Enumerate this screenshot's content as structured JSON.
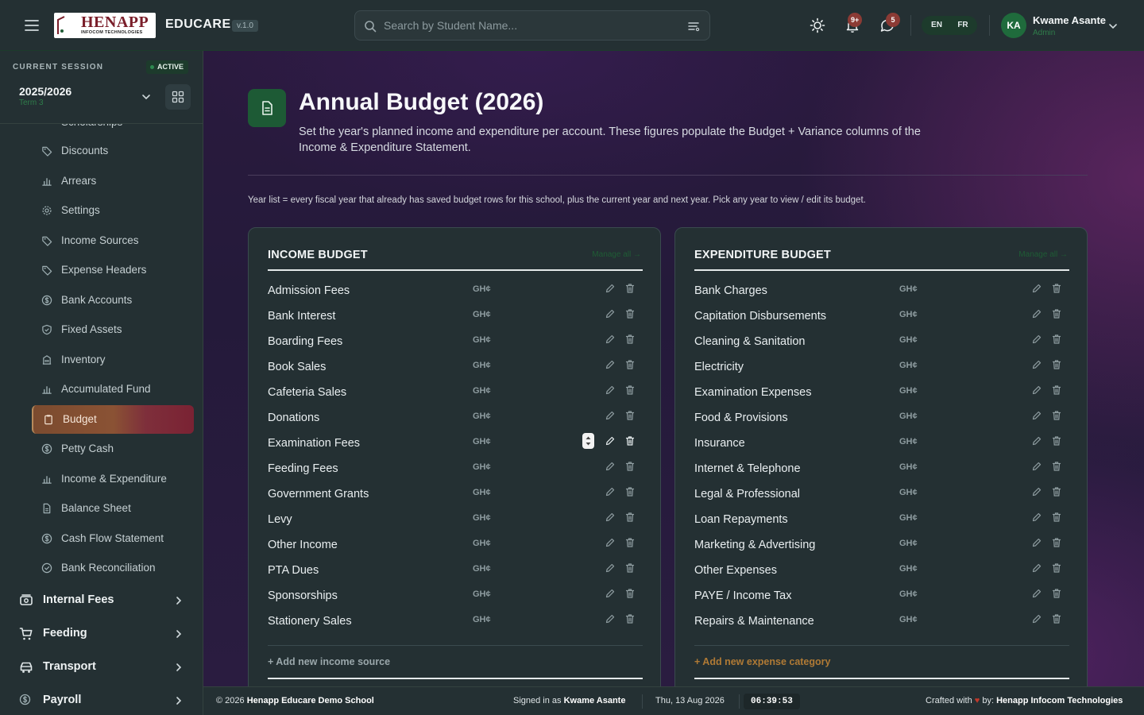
{
  "app": {
    "logo_text": "HENAPP",
    "logo_sub": "INFOCOM TECHNOLOGIES",
    "name": "EDUCARE",
    "version": "v.1.0"
  },
  "header": {
    "search_placeholder": "Search by Student Name...",
    "notifications_count": "9+",
    "messages_count": "5",
    "languages": [
      "EN",
      "FR"
    ],
    "user": {
      "initials": "KA",
      "name": "Kwame Asante",
      "role": "Admin"
    }
  },
  "session": {
    "label": "CURRENT SESSION",
    "status": "ACTIVE",
    "year": "2025/2026",
    "term": "Term 3"
  },
  "sidebar": {
    "partial_item": "Scholarships",
    "items": [
      {
        "label": "Discounts",
        "icon": "tag-icon"
      },
      {
        "label": "Arrears",
        "icon": "bar-chart-icon"
      },
      {
        "label": "Settings",
        "icon": "gear-icon"
      },
      {
        "label": "Income Sources",
        "icon": "tag-icon"
      },
      {
        "label": "Expense Headers",
        "icon": "tag-icon"
      },
      {
        "label": "Bank Accounts",
        "icon": "dollar-circle-icon"
      },
      {
        "label": "Fixed Assets",
        "icon": "shield-icon"
      },
      {
        "label": "Inventory",
        "icon": "building-icon"
      },
      {
        "label": "Accumulated Fund",
        "icon": "bar-chart-icon"
      },
      {
        "label": "Budget",
        "icon": "clipboard-icon",
        "active": true
      },
      {
        "label": "Petty Cash",
        "icon": "dollar-circle-icon"
      },
      {
        "label": "Income & Expenditure",
        "icon": "bar-chart-icon"
      },
      {
        "label": "Balance Sheet",
        "icon": "document-icon"
      },
      {
        "label": "Cash Flow Statement",
        "icon": "dollar-circle-icon"
      },
      {
        "label": "Bank Reconciliation",
        "icon": "check-circle-icon"
      }
    ],
    "groups": [
      {
        "label": "Internal Fees",
        "icon": "cash-icon"
      },
      {
        "label": "Feeding",
        "icon": "cart-icon"
      },
      {
        "label": "Transport",
        "icon": "car-icon"
      },
      {
        "label": "Payroll",
        "icon": "dollar-circle-icon"
      }
    ]
  },
  "page": {
    "title": "Annual Budget (2026)",
    "description": "Set the year's planned income and expenditure per account. These figures populate the Budget + Variance columns of the Income & Expenditure Statement.",
    "help_text": "Year list = every fiscal year that already has saved budget rows for this school, plus the current year and next year. Pick any year to view / edit its budget."
  },
  "income_budget": {
    "title": "INCOME BUDGET",
    "manage_label": "Manage all →",
    "currency": "GH¢",
    "rows": [
      "Admission Fees",
      "Bank Interest",
      "Boarding Fees",
      "Book Sales",
      "Cafeteria Sales",
      "Donations",
      "Examination Fees",
      "Feeding Fees",
      "Government Grants",
      "Levy",
      "Other Income",
      "PTA Dues",
      "Sponsorships",
      "Stationery Sales"
    ],
    "add_label": "+ Add new income source"
  },
  "expenditure_budget": {
    "title": "EXPENDITURE BUDGET",
    "manage_label": "Manage all →",
    "currency": "GH¢",
    "rows": [
      "Bank Charges",
      "Capitation Disbursements",
      "Cleaning & Sanitation",
      "Electricity",
      "Examination Expenses",
      "Food & Provisions",
      "Insurance",
      "Internet & Telephone",
      "Legal & Professional",
      "Loan Repayments",
      "Marketing & Advertising",
      "Other Expenses",
      "PAYE / Income Tax",
      "Repairs & Maintenance"
    ],
    "add_label": "+ Add new expense category"
  },
  "footer": {
    "copyright": "© 2026",
    "school": "Henapp Educare Demo School",
    "signed_in_prefix": "Signed in as",
    "signed_in_user": "Kwame Asante",
    "date": "Thu, 13 Aug 2026",
    "time": "06:39:53",
    "crafted_prefix": "Crafted with",
    "crafted_suffix": "by:",
    "company": "Henapp Infocom Technologies"
  },
  "colors": {
    "accent_green": "#1d5a35",
    "income_add_link": "#9aa7ab",
    "expense_add_link": "#b07a35",
    "active_nav": "#8a5234"
  }
}
